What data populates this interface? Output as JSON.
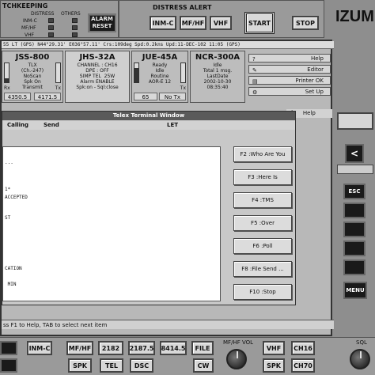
{
  "watchkeeping": {
    "title": "TCHKEEPING",
    "col_distress": "DISTRESS",
    "col_others": "OTHERS",
    "rows": [
      "INM-C",
      "MF/HF",
      "VHF"
    ],
    "alarm_reset": "ALARM RESET"
  },
  "distress_alert": {
    "title": "DISTRESS ALERT",
    "buttons": [
      "INM-C",
      "MF/HF",
      "VHF"
    ],
    "start": "START",
    "stop": "STOP"
  },
  "brand": "IZUM",
  "status_bar": "55 LT (GPS)  N44°29.31' E036°57.11' Crs:109deg Spd:0.2kns Upd:11-DEC-102 11:05 (GPS)",
  "channels": [
    {
      "name": "JSS-800",
      "info": "TLX\n(Ch.-247)\nNoScan\nSpk On\nTransmit",
      "rx": "Rx",
      "tx": "Tx",
      "left_value": "4350.5",
      "right_value": "4171.5",
      "rx_level": 0.2,
      "tx_level": 0.0
    },
    {
      "name": "JHS-32A",
      "info": "CHANNEL : CH16\nDPE : OFF\nSIMP TEL  25W\nAlarm ENABLE\nSpk:on - Sql:close",
      "rx": "",
      "tx": "",
      "left_value": "",
      "right_value": "",
      "rx_level": 0,
      "tx_level": 0
    },
    {
      "name": "JUE-45A",
      "info": "Ready\nIdle\nRoutine\nAOR-E 12",
      "rx": "",
      "tx": "Tx",
      "left_value": "65",
      "right_value": "No Tx",
      "rx_level": 0.75,
      "tx_level": 0.0
    },
    {
      "name": "NCR-300A",
      "info": "Idle\nTotal 1 msg.\nLastDate\n2002-10-30\n08:35:40",
      "rx": "",
      "tx": "",
      "left_value": "",
      "right_value": "",
      "rx_level": 0,
      "tx_level": 0
    }
  ],
  "right_menu": [
    {
      "icon": "?",
      "label": "Help"
    },
    {
      "icon": "✎",
      "label": "Editor"
    },
    {
      "icon": "▤",
      "label": "Printer OK"
    },
    {
      "icon": "⚙",
      "label": "Set Up"
    }
  ],
  "menu_fragment_k": "k",
  "menu_fragment_help": "Help",
  "telex": {
    "title": "Telex Terminal Window",
    "col_calling": "Calling",
    "col_send": "Send",
    "col_let": "LET",
    "lines": [
      {
        "text": "..."
      },
      {
        "text": "1*"
      },
      {
        "text": "ACCEPTED"
      },
      {
        "text": "ST"
      },
      {
        "text": "CATION"
      },
      {
        "text": " MIN"
      }
    ],
    "fkeys": [
      "F2 :Who Are You",
      "F3 :Here Is",
      "F4 :TMS",
      "F5 :Over",
      "F6 :Poll",
      "F8 :File Send ...",
      "F10 :Stop"
    ]
  },
  "bottom_status": "ss F1 to Help, TAB to select next item",
  "right_keypad": {
    "arrow": "<",
    "esc": "ESC",
    "menu": "MENU"
  },
  "bottom_row1": [
    "INM-C",
    "MF/HF",
    "2182",
    "2187.5",
    "8414.5",
    "FILE"
  ],
  "bottom_row2": [
    "SPK",
    "TEL",
    "DSC",
    "CW"
  ],
  "mfhf_vol": "MF/HF VOL",
  "vhf_group": [
    "VHF",
    "CH16",
    "SPK",
    "CH70"
  ],
  "sql": "SQL"
}
